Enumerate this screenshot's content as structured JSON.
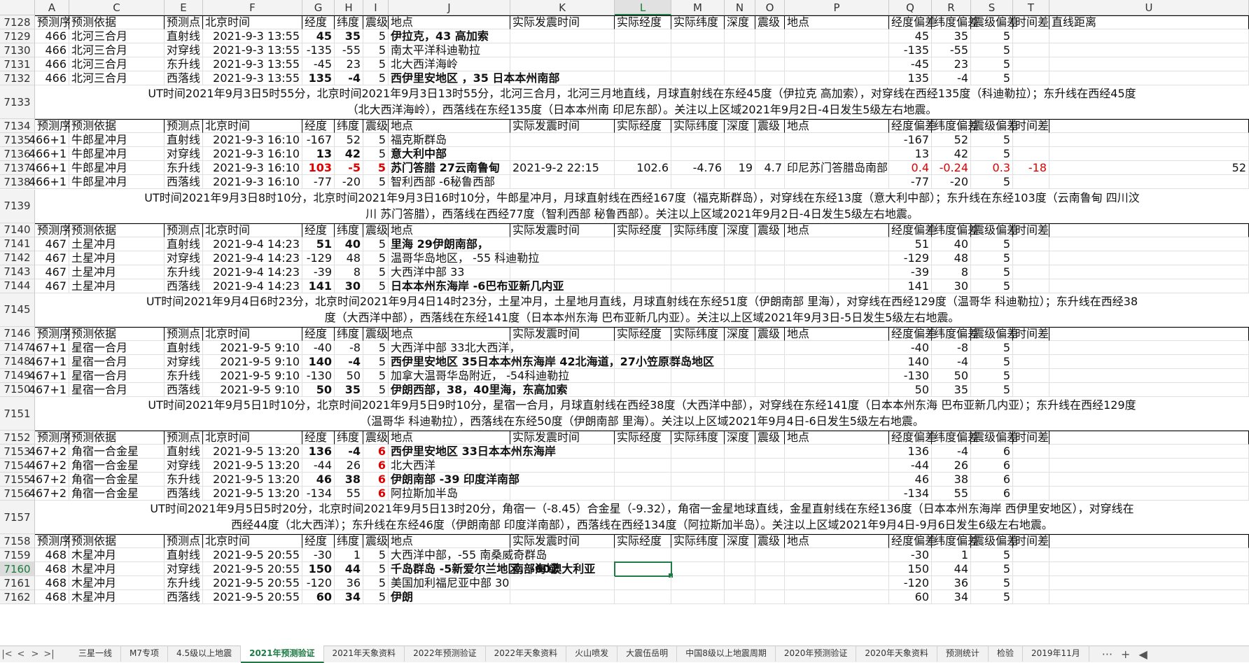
{
  "columns": [
    "A",
    "C",
    "E",
    "F",
    "G",
    "H",
    "I",
    "J",
    "K",
    "L",
    "M",
    "N",
    "O",
    "P",
    "Q",
    "R",
    "S",
    "T",
    "U"
  ],
  "selected_column": "L",
  "selected_row": "7160",
  "rows": [
    {
      "n": "7128",
      "type": "data",
      "cells": [
        "预测序",
        "预测依据",
        "预测点",
        "北京时间",
        "经度",
        "纬度",
        "震级",
        "地点",
        "实际发震时间",
        "实际经度",
        "实际纬度",
        "深度",
        "震级",
        "地点",
        "经度偏差",
        "纬度偏差",
        "震级偏差",
        "时间差",
        "直线距离"
      ]
    },
    {
      "n": "7129",
      "type": "data",
      "cells": [
        "466",
        "北河三合月",
        "直射线",
        "2021-9-3 13:55",
        "45",
        "35",
        "5",
        "伊拉克，43  高加索",
        "",
        "",
        "",
        "",
        "",
        "",
        "45",
        "35",
        "5",
        "",
        ""
      ]
    },
    {
      "n": "7130",
      "type": "data",
      "cells": [
        "466",
        "北河三合月",
        "对穿线",
        "2021-9-3 13:55",
        "-135",
        "-55",
        "5",
        "南太平洋科迪勒拉",
        "",
        "",
        "",
        "",
        "",
        "",
        "-135",
        "-55",
        "5",
        "",
        ""
      ]
    },
    {
      "n": "7131",
      "type": "data",
      "cells": [
        "466",
        "北河三合月",
        "东升线",
        "2021-9-3 13:55",
        "-45",
        "23",
        "5",
        "北大西洋海岭",
        "",
        "",
        "",
        "",
        "",
        "",
        "-45",
        "23",
        "5",
        "",
        ""
      ]
    },
    {
      "n": "7132",
      "type": "data",
      "cells": [
        "466",
        "北河三合月",
        "西落线",
        "2021-9-3 13:55",
        "135",
        "-4",
        "5",
        "西伊里安地区 ，35  日本本州南部",
        "",
        "",
        "",
        "",
        "",
        "",
        "135",
        "-4",
        "5",
        "",
        ""
      ]
    },
    {
      "n": "7133",
      "type": "merged",
      "lines": [
        "UT时间2021年9月3日5时55分，北京时间2021年9月3日13时55分，北河三合月，北河三月地直线，月球直射线在东经45度（伊拉克 高加索），对穿线在西经135度（科迪勒拉）；东升线在西经45度",
        "（北大西洋海岭），西落线在东经135度（日本本州南 印尼东部）。关注以上区域2021年9月2日-4日发生5级左右地震。"
      ]
    },
    {
      "n": "7134",
      "type": "data",
      "cells": [
        "预测序",
        "预测依据",
        "预测点",
        "北京时间",
        "经度",
        "纬度",
        "震级",
        "地点",
        "实际发震时间",
        "实际经度",
        "实际纬度",
        "深度",
        "震级",
        "地点",
        "经度偏差",
        "纬度偏差",
        "震级偏差",
        "时间差",
        ""
      ]
    },
    {
      "n": "7135",
      "type": "data",
      "cells": [
        "466+1",
        "牛郎星冲月",
        "直射线",
        "2021-9-3 16:10",
        "-167",
        "52",
        "5",
        "福克斯群岛",
        "",
        "",
        "",
        "",
        "",
        "",
        "-167",
        "52",
        "5",
        "",
        ""
      ]
    },
    {
      "n": "7136",
      "type": "data",
      "cells": [
        "466+1",
        "牛郎星冲月",
        "对穿线",
        "2021-9-3 16:10",
        "13",
        "42",
        "5",
        "意大利中部",
        "",
        "",
        "",
        "",
        "",
        "",
        "13",
        "42",
        "5",
        "",
        ""
      ]
    },
    {
      "n": "7137",
      "type": "data",
      "cells": [
        "466+1",
        "牛郎星冲月",
        "东升线",
        "2021-9-3 16:10",
        "103",
        "-5",
        "5",
        "苏门答腊 27云南鲁甸",
        "2021-9-2 22:15",
        "102.6",
        "-4.76",
        "19",
        "4.7",
        "印尼苏门答腊岛南部",
        "0.4",
        "-0.24",
        "0.3",
        "-18",
        "52"
      ]
    },
    {
      "n": "7138",
      "type": "data",
      "cells": [
        "466+1",
        "牛郎星冲月",
        "西落线",
        "2021-9-3 16:10",
        "-77",
        "-20",
        "5",
        "智利西部 -6秘鲁西部",
        "",
        "",
        "",
        "",
        "",
        "",
        "-77",
        "-20",
        "5",
        "",
        ""
      ]
    },
    {
      "n": "7139",
      "type": "merged",
      "lines": [
        "UT时间2021年9月3日8时10分，北京时间2021年9月3日16时10分，牛郎星冲月，月球直射线在西经167度（福克斯群岛），对穿线在东经13度（意大利中部）；东升线在东经103度（云南鲁甸 四川汶",
        "川 苏门答腊），西落线在西经77度（智利西部 秘鲁西部）。关注以上区域2021年9月2日-4日发生5级左右地震。"
      ]
    },
    {
      "n": "7140",
      "type": "data",
      "cells": [
        "预测序",
        "预测依据",
        "预测点",
        "北京时间",
        "经度",
        "纬度",
        "震级",
        "地点",
        "实际发震时间",
        "实际经度",
        "实际纬度",
        "深度",
        "震级",
        "地点",
        "经度偏差",
        "纬度偏差",
        "震级偏差",
        "时间差",
        ""
      ]
    },
    {
      "n": "7141",
      "type": "data",
      "cells": [
        "467",
        "土星冲月",
        "直射线",
        "2021-9-4 14:23",
        "51",
        "40",
        "5",
        "里海 29伊朗南部，",
        "",
        "",
        "",
        "",
        "",
        "",
        "51",
        "40",
        "5",
        "",
        ""
      ]
    },
    {
      "n": "7142",
      "type": "data",
      "cells": [
        "467",
        "土星冲月",
        "对穿线",
        "2021-9-4 14:23",
        "-129",
        "48",
        "5",
        "温哥华岛地区， -55 科迪勒拉",
        "",
        "",
        "",
        "",
        "",
        "",
        "-129",
        "48",
        "5",
        "",
        ""
      ]
    },
    {
      "n": "7143",
      "type": "data",
      "cells": [
        "467",
        "土星冲月",
        "东升线",
        "2021-9-4 14:23",
        "-39",
        "8",
        "5",
        "大西洋中部 33",
        "",
        "",
        "",
        "",
        "",
        "",
        "-39",
        "8",
        "5",
        "",
        ""
      ]
    },
    {
      "n": "7144",
      "type": "data",
      "cells": [
        "467",
        "土星冲月",
        "西落线",
        "2021-9-4 14:23",
        "141",
        "30",
        "5",
        "日本本州东海岸 -6巴布亚新几内亚",
        "",
        "",
        "",
        "",
        "",
        "",
        "141",
        "30",
        "5",
        "",
        ""
      ]
    },
    {
      "n": "7145",
      "type": "merged",
      "lines": [
        "UT时间2021年9月4日6时23分，北京时间2021年9月4日14时23分，土星冲月，土星地月直线，月球直射线在东经51度（伊朗南部 里海），对穿线在西经129度（温哥华 科迪勒拉）；东升线在西经38",
        "度（大西洋中部），西落线在东经141度（日本本州东海 巴布亚新几内亚）。关注以上区域2021年9月3日-5日发生5级左右地震。"
      ]
    },
    {
      "n": "7146",
      "type": "data",
      "cells": [
        "预测序",
        "预测依据",
        "预测点",
        "北京时间",
        "经度",
        "纬度",
        "震级",
        "地点",
        "实际发震时间",
        "实际经度",
        "实际纬度",
        "深度",
        "震级",
        "地点",
        "经度偏差",
        "纬度偏差",
        "震级偏差",
        "时间差",
        ""
      ]
    },
    {
      "n": "7147",
      "type": "data",
      "cells": [
        "467+1",
        "星宿一合月",
        "直射线",
        "2021-9-5 9:10",
        "-40",
        "-8",
        "5",
        "大西洋中部 33北大西洋，",
        "",
        "",
        "",
        "",
        "",
        "",
        "-40",
        "-8",
        "5",
        "",
        ""
      ]
    },
    {
      "n": "7148",
      "type": "data",
      "cells": [
        "467+1",
        "星宿一合月",
        "对穿线",
        "2021-9-5 9:10",
        "140",
        "-4",
        "5",
        "西伊里安地区 35日本本州东海岸  42北海道，27小笠原群岛地区",
        "",
        "",
        "",
        "",
        "",
        "",
        "140",
        "-4",
        "5",
        "",
        ""
      ]
    },
    {
      "n": "7149",
      "type": "data",
      "cells": [
        "467+1",
        "星宿一合月",
        "东升线",
        "2021-9-5 9:10",
        "-130",
        "50",
        "5",
        "加拿大温哥华岛附近， -54科迪勒拉",
        "",
        "",
        "",
        "",
        "",
        "",
        "-130",
        "50",
        "5",
        "",
        ""
      ]
    },
    {
      "n": "7150",
      "type": "data",
      "cells": [
        "467+1",
        "星宿一合月",
        "西落线",
        "2021-9-5 9:10",
        "50",
        "35",
        "5",
        "伊朗西部，38，40里海，东高加索",
        "",
        "",
        "",
        "",
        "",
        "",
        "50",
        "35",
        "5",
        "",
        ""
      ]
    },
    {
      "n": "7151",
      "type": "merged",
      "lines": [
        "UT时间2021年9月5日1时10分，北京时间2021年9月5日9时10分，星宿一合月，月球直射线在西经38度（大西洋中部），对穿线在东经141度（日本本州东海 巴布亚新几内亚）；东升线在西经129度",
        "（温哥华 科迪勒拉），西落线在东经50度（伊朗南部 里海）。关注以上区域2021年9月4日-6日发生5级左右地震。"
      ]
    },
    {
      "n": "7152",
      "type": "data",
      "cells": [
        "预测序",
        "预测依据",
        "预测点",
        "北京时间",
        "经度",
        "纬度",
        "震级",
        "地点",
        "实际发震时间",
        "实际经度",
        "实际纬度",
        "深度",
        "震级",
        "地点",
        "经度偏差",
        "纬度偏差",
        "震级偏差",
        "时间差",
        ""
      ]
    },
    {
      "n": "7153",
      "type": "data",
      "cells": [
        "467+2",
        "角宿一合金星",
        "直射线",
        "2021-9-5 13:20",
        "136",
        "-4",
        "6",
        "西伊里安地区 33日本本州东海岸",
        "",
        "",
        "",
        "",
        "",
        "",
        "136",
        "-4",
        "6",
        "",
        ""
      ]
    },
    {
      "n": "7154",
      "type": "data",
      "cells": [
        "467+2",
        "角宿一合金星",
        "对穿线",
        "2021-9-5 13:20",
        "-44",
        "26",
        "6",
        "北大西洋",
        "",
        "",
        "",
        "",
        "",
        "",
        "-44",
        "26",
        "6",
        "",
        ""
      ]
    },
    {
      "n": "7155",
      "type": "data",
      "cells": [
        "467+2",
        "角宿一合金星",
        "东升线",
        "2021-9-5 13:20",
        "46",
        "38",
        "6",
        "伊朗南部 -39  印度洋南部",
        "",
        "",
        "",
        "",
        "",
        "",
        "46",
        "38",
        "6",
        "",
        ""
      ]
    },
    {
      "n": "7156",
      "type": "data",
      "cells": [
        "467+2",
        "角宿一合金星",
        "西落线",
        "2021-9-5 13:20",
        "-134",
        "55",
        "6",
        "阿拉斯加半岛",
        "",
        "",
        "",
        "",
        "",
        "",
        "-134",
        "55",
        "6",
        "",
        ""
      ]
    },
    {
      "n": "7157",
      "type": "merged",
      "lines": [
        "UT时间2021年9月5日5时20分，北京时间2021年9月5日13时20分，角宿一（-8.45）合金星（-9.32），角宿一金星地球直线，金星直射线在东经136度（日本本州东海岸 西伊里安地区），对穿线在",
        "西经44度（北大西洋）；东升线在东经46度（伊朗南部 印度洋南部），西落线在西经134度（阿拉斯加半岛）。关注以上区域2021年9月4日-9月6日发生6级左右地震。"
      ]
    },
    {
      "n": "7158",
      "type": "data",
      "cells": [
        "预测序",
        "预测依据",
        "预测点",
        "北京时间",
        "经度",
        "纬度",
        "震级",
        "地点",
        "实际发震时间",
        "实际经度",
        "实际纬度",
        "深度",
        "震级",
        "地点",
        "经度偏差",
        "纬度偏差",
        "震级偏差",
        "时间差",
        ""
      ]
    },
    {
      "n": "7159",
      "type": "data",
      "cells": [
        "468",
        "木星冲月",
        "直射线",
        "2021-9-5 20:55",
        "-30",
        "1",
        "5",
        "大西洋中部，-55 南桑威奇群岛",
        "",
        "",
        "",
        "",
        "",
        "",
        "-30",
        "1",
        "5",
        "",
        ""
      ]
    },
    {
      "n": "7160",
      "type": "data",
      "cells": [
        "468",
        "木星冲月",
        "对穿线",
        "2021-9-5 20:55",
        "150",
        "44",
        "5",
        "千岛群岛 -5新爱尔兰地区，-60澳大利亚",
        "南部海域",
        "",
        "",
        "",
        "",
        "",
        "150",
        "44",
        "5",
        "",
        ""
      ]
    },
    {
      "n": "7161",
      "type": "data",
      "cells": [
        "468",
        "木星冲月",
        "东升线",
        "2021-9-5 20:55",
        "-120",
        "36",
        "5",
        "美国加利福尼亚中部 30",
        "",
        "",
        "",
        "",
        "",
        "",
        "-120",
        "36",
        "5",
        "",
        ""
      ]
    },
    {
      "n": "7162",
      "type": "data",
      "cells": [
        "468",
        "木星冲月",
        "西落线",
        "2021-9-5 20:55",
        "60",
        "34",
        "5",
        "伊朗",
        "",
        "",
        "",
        "",
        "",
        "",
        "60",
        "34",
        "5",
        "",
        ""
      ]
    }
  ],
  "tabs": [
    "三星一线",
    "M7专项",
    "4.5级以上地震",
    "2021年预测验证",
    "2021年天象资料",
    "2022年预测验证",
    "2022年天象资料",
    "火山喷发",
    "大震伍岳明",
    "中国8级以上地震周期",
    "2020年预测验证",
    "2020年天象资料",
    "预测统计",
    "检验",
    "2019年11月"
  ],
  "active_tab": "2021年预测验证",
  "tab_nav": [
    "|<",
    "<",
    ">",
    ">|"
  ],
  "tab_tools": [
    "···",
    "+",
    "◀"
  ]
}
